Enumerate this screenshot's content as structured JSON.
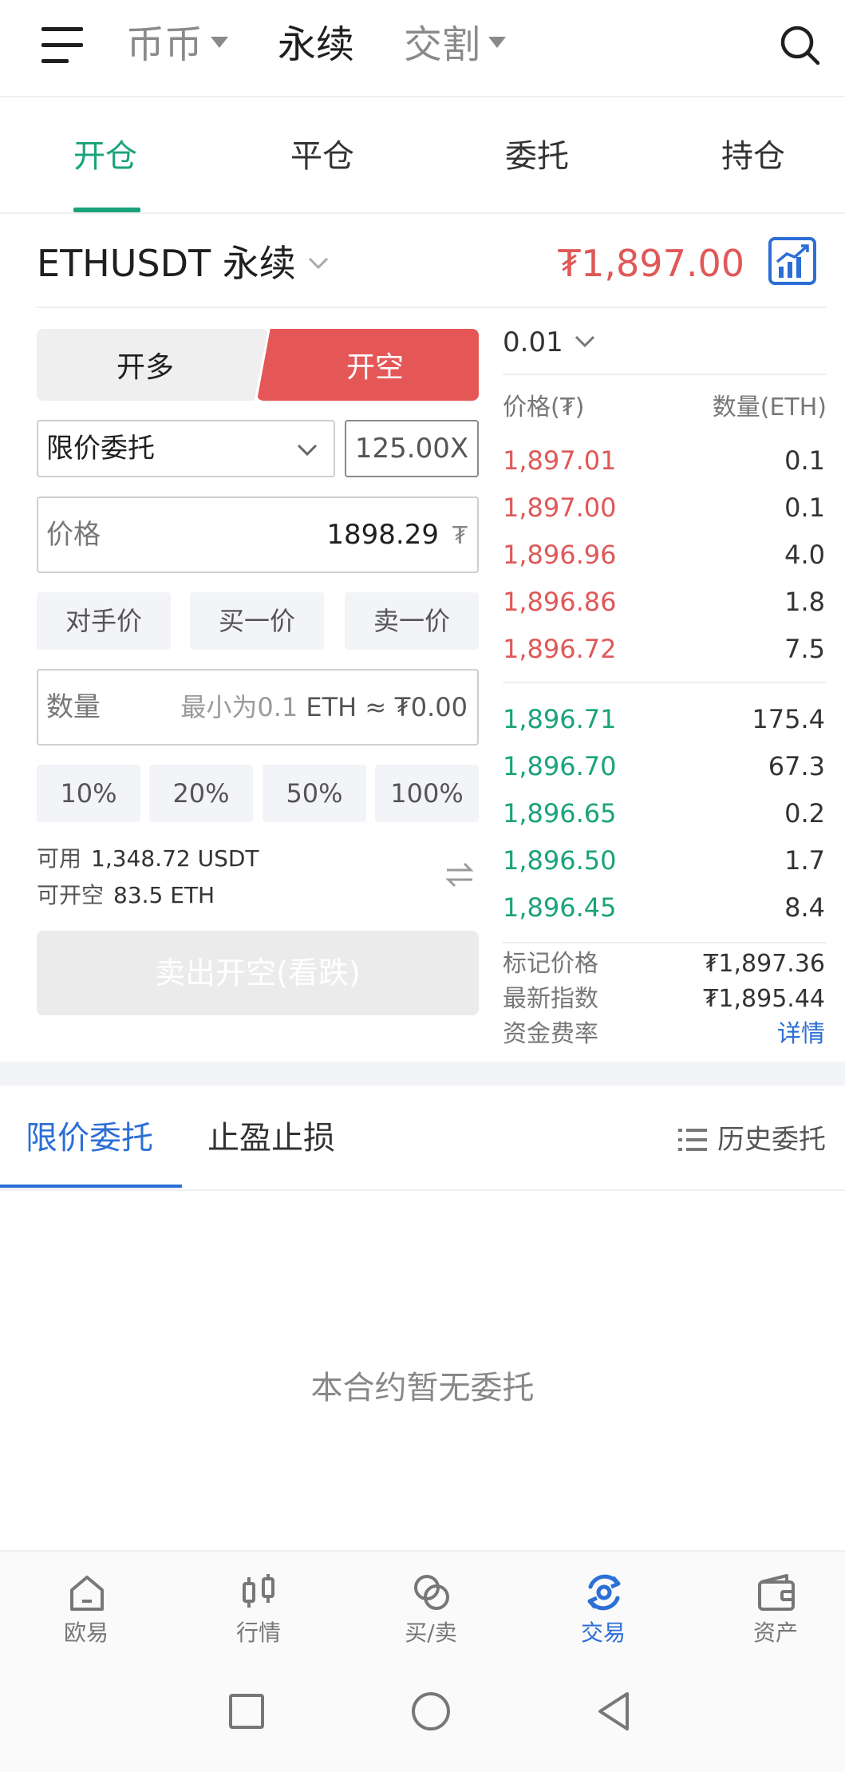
{
  "topnav": {
    "spot": "币币",
    "perpetual": "永续",
    "delivery": "交割"
  },
  "tabs": [
    "开仓",
    "平仓",
    "委托",
    "持仓"
  ],
  "instrument": {
    "name": "ETHUSDT 永续",
    "last_price": "₮1,897.00"
  },
  "form": {
    "long_label": "开多",
    "short_label": "开空",
    "order_type": "限价委托",
    "leverage": "125.00X",
    "price_label": "价格",
    "price_value": "1898.29",
    "price_unit": "₮",
    "quick_prices": [
      "对手价",
      "买一价",
      "卖一价"
    ],
    "qty_label": "数量",
    "qty_placeholder": "最小为0.1",
    "qty_unit_estimate": "ETH ≈ ₮0.00",
    "percentages": [
      "10%",
      "20%",
      "50%",
      "100%"
    ],
    "available_label": "可用",
    "available_value": "1,348.72 USDT",
    "openable_label": "可开空",
    "openable_value": "83.5 ETH",
    "submit_label": "卖出开空(看跌)"
  },
  "orderbook": {
    "tick_size": "0.01",
    "header_price": "价格(₮)",
    "header_qty": "数量(ETH)",
    "asks": [
      {
        "price": "1,897.01",
        "qty": "0.1"
      },
      {
        "price": "1,897.00",
        "qty": "0.1"
      },
      {
        "price": "1,896.96",
        "qty": "4.0"
      },
      {
        "price": "1,896.86",
        "qty": "1.8"
      },
      {
        "price": "1,896.72",
        "qty": "7.5"
      }
    ],
    "bids": [
      {
        "price": "1,896.71",
        "qty": "175.4"
      },
      {
        "price": "1,896.70",
        "qty": "67.3"
      },
      {
        "price": "1,896.65",
        "qty": "0.2"
      },
      {
        "price": "1,896.50",
        "qty": "1.7"
      },
      {
        "price": "1,896.45",
        "qty": "8.4"
      }
    ],
    "mark_label": "标记价格",
    "mark_value": "₮1,897.36",
    "index_label": "最新指数",
    "index_value": "₮1,895.44",
    "funding_label": "资金费率",
    "funding_link": "详情"
  },
  "orders": {
    "tab_limit": "限价委托",
    "tab_tpsl": "止盈止损",
    "history": "历史委托",
    "empty": "本合约暂无委托"
  },
  "bottombar": [
    "欧易",
    "行情",
    "买/卖",
    "交易",
    "资产"
  ],
  "colors": {
    "green": "#1aa37a",
    "red": "#e05858",
    "blue": "#2c6fd6"
  }
}
